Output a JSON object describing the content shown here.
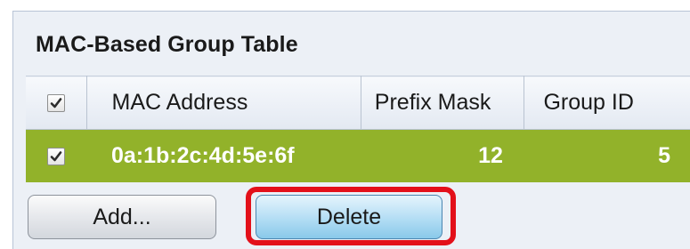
{
  "panel": {
    "title": "MAC-Based Group Table"
  },
  "table": {
    "header": {
      "select_all_checked": true,
      "columns": [
        "MAC Address",
        "Prefix Mask",
        "Group ID"
      ]
    },
    "rows": [
      {
        "selected": true,
        "mac_address": "0a:1b:2c:4d:5e:6f",
        "prefix_mask": "12",
        "group_id": "5"
      }
    ]
  },
  "buttons": {
    "add_label": "Add...",
    "delete_label": "Delete"
  },
  "colors": {
    "selected_row": "#92b22a",
    "highlight": "#e3101a",
    "delete_button": "#89c9ea"
  },
  "icons": {
    "checkbox": "checkmark-icon"
  }
}
